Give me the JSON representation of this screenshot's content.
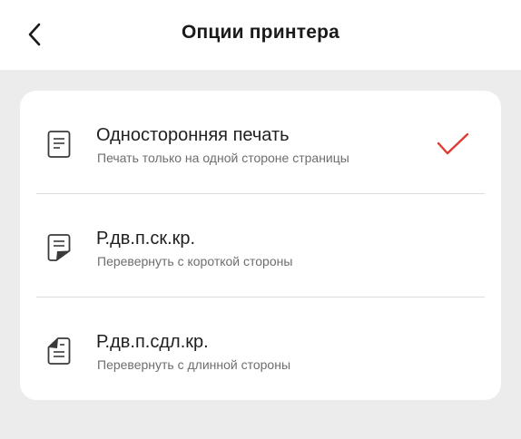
{
  "header": {
    "title": "Опции принтера",
    "back_icon": "chevron-left-icon"
  },
  "options": [
    {
      "title": "Односторонняя печать",
      "subtitle": "Печать только на одной стороне страницы",
      "icon": "document-single-side-icon",
      "selected": true
    },
    {
      "title": "Р.дв.п.ск.кр.",
      "subtitle": "Перевернуть с короткой стороны",
      "icon": "document-flip-short-edge-icon",
      "selected": false
    },
    {
      "title": "Р.дв.п.сдл.кр.",
      "subtitle": "Перевернуть с длинной стороны",
      "icon": "document-flip-long-edge-icon",
      "selected": false
    }
  ],
  "colors": {
    "accent_check": "#e03a32",
    "background": "#ececec",
    "card": "#ffffff"
  }
}
